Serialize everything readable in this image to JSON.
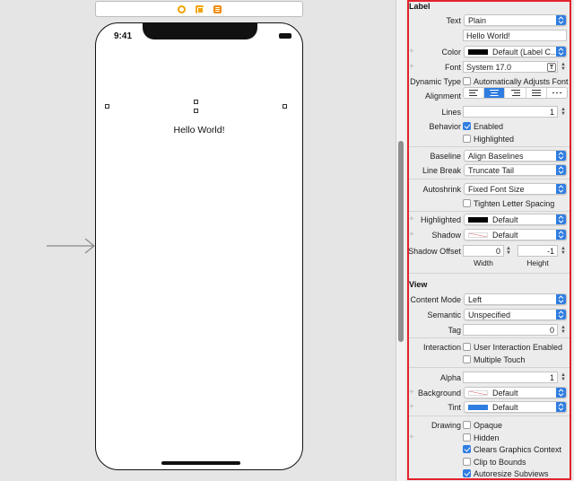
{
  "canvas": {
    "scene_icons": [
      "view-controller-icon",
      "first-responder-icon",
      "exit-icon"
    ],
    "status_time": "9:41",
    "label_text": "Hello World!"
  },
  "inspector": {
    "label_section": {
      "title": "Label",
      "text": {
        "label": "Text",
        "value": "Plain",
        "content": "Hello World!"
      },
      "color": {
        "label": "Color",
        "value": "Default (Label C..."
      },
      "font": {
        "label": "Font",
        "value": "System 17.0"
      },
      "dynamic_type": {
        "label": "Dynamic Type",
        "option": "Automatically Adjusts Font",
        "checked": false
      },
      "alignment": {
        "label": "Alignment",
        "options": [
          "left",
          "center",
          "right",
          "justified",
          "natural"
        ],
        "selected": "center"
      },
      "lines": {
        "label": "Lines",
        "value": "1"
      },
      "behavior": {
        "label": "Behavior",
        "enabled": "Enabled",
        "enabled_checked": true,
        "highlighted": "Highlighted",
        "highlighted_checked": false
      },
      "baseline": {
        "label": "Baseline",
        "value": "Align Baselines"
      },
      "line_break": {
        "label": "Line Break",
        "value": "Truncate Tail"
      },
      "autoshrink": {
        "label": "Autoshrink",
        "value": "Fixed Font Size",
        "tighten": "Tighten Letter Spacing",
        "tighten_checked": false
      },
      "highlighted_color": {
        "label": "Highlighted",
        "value": "Default"
      },
      "shadow": {
        "label": "Shadow",
        "value": "Default"
      },
      "shadow_offset": {
        "label": "Shadow Offset",
        "width": "0",
        "height": "-1",
        "width_label": "Width",
        "height_label": "Height"
      }
    },
    "view_section": {
      "title": "View",
      "content_mode": {
        "label": "Content Mode",
        "value": "Left"
      },
      "semantic": {
        "label": "Semantic",
        "value": "Unspecified"
      },
      "tag": {
        "label": "Tag",
        "value": "0"
      },
      "interaction": {
        "label": "Interaction",
        "user_interaction": "User Interaction Enabled",
        "user_interaction_checked": false,
        "multiple_touch": "Multiple Touch",
        "multiple_touch_checked": false
      },
      "alpha": {
        "label": "Alpha",
        "value": "1"
      },
      "background": {
        "label": "Background",
        "value": "Default"
      },
      "tint": {
        "label": "Tint",
        "value": "Default"
      },
      "drawing": {
        "label": "Drawing",
        "options": [
          {
            "label": "Opaque",
            "checked": false
          },
          {
            "label": "Hidden",
            "checked": false
          },
          {
            "label": "Clears Graphics Context",
            "checked": true
          },
          {
            "label": "Clip to Bounds",
            "checked": false
          },
          {
            "label": "Autoresize Subviews",
            "checked": true
          }
        ]
      }
    }
  },
  "colors": {
    "accent": "#2f7de1",
    "highlight_border": "#e3222b",
    "tint_swatch": "#2f7de1"
  }
}
